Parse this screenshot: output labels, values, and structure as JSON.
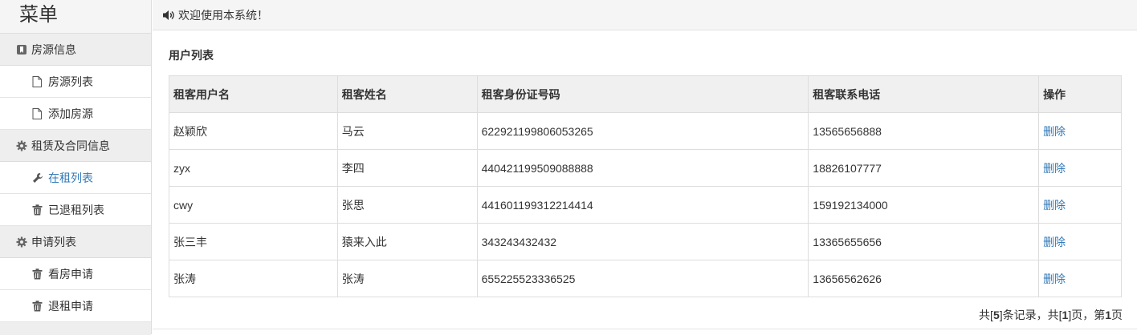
{
  "sidebar": {
    "title": "菜单",
    "groups": [
      {
        "label": "房源信息",
        "icon": "bookmark-icon",
        "items": [
          {
            "label": "房源列表",
            "icon": "file-icon"
          },
          {
            "label": "添加房源",
            "icon": "file-icon"
          }
        ]
      },
      {
        "label": "租赁及合同信息",
        "icon": "gear-icon",
        "items": [
          {
            "label": "在租列表",
            "icon": "wrench-icon",
            "active": true
          },
          {
            "label": "已退租列表",
            "icon": "trash-icon"
          }
        ]
      },
      {
        "label": "申请列表",
        "icon": "gear-icon",
        "items": [
          {
            "label": "看房申请",
            "icon": "trash-icon"
          },
          {
            "label": "退租申请",
            "icon": "trash-icon"
          }
        ]
      }
    ]
  },
  "topbar": {
    "icon": "volume-icon",
    "welcome": "欢迎使用本系统！"
  },
  "main": {
    "title": "用户列表",
    "table": {
      "headers": [
        "租客用户名",
        "租客姓名",
        "租客身份证号码",
        "租客联系电话",
        "操作"
      ],
      "rows": [
        [
          "赵颖欣",
          "马云",
          "622921199806053265",
          "13565656888",
          "删除"
        ],
        [
          "zyx",
          "李四",
          "440421199509088888",
          "18826107777",
          "删除"
        ],
        [
          "cwy",
          "张思",
          "441601199312214414",
          "159192134000",
          "删除"
        ],
        [
          "张三丰",
          "猿来入此",
          "343243432432",
          "13365655656",
          "删除"
        ],
        [
          "张涛",
          "张涛",
          "655225523336525",
          "13656562626",
          "删除"
        ]
      ]
    },
    "pager": {
      "p1": "共[",
      "total": "5",
      "p2": "]条记录，共[",
      "pages": "1",
      "p3": "]页，第",
      "current": "1",
      "p4": "页"
    }
  },
  "colors": {
    "link": "#337ab7",
    "sidebar_bg": "#f5f5f5",
    "group_bg": "#eeeeee",
    "table_header_bg": "#f0f0f0"
  }
}
